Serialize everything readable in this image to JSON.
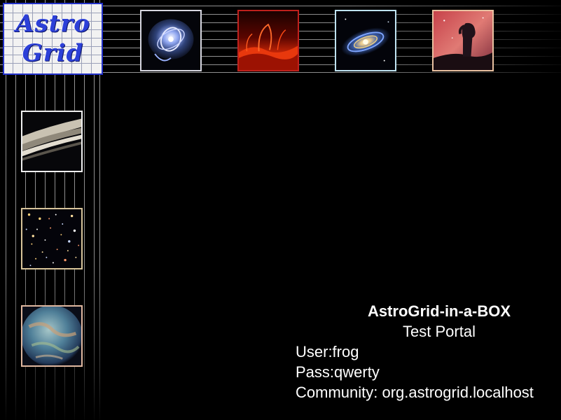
{
  "logo": {
    "line1": "Astro",
    "line2": "Grid"
  },
  "thumbnails": {
    "top": [
      "cats-eye-nebula",
      "solar-flare",
      "spiral-galaxy",
      "horsehead-nebula"
    ],
    "left": [
      "saturn-rings",
      "deep-field",
      "blue-planet"
    ]
  },
  "portal": {
    "title": "AstroGrid-in-a-BOX",
    "subtitle": "Test Portal",
    "user": "User:frog",
    "pass": "Pass:qwerty",
    "community": "Community: org.astrogrid.localhost"
  },
  "colors": {
    "background": "#000000",
    "logo_border": "#2331c9",
    "logo_text": "#2c40d8",
    "grid_line": "#9a9a9a"
  }
}
